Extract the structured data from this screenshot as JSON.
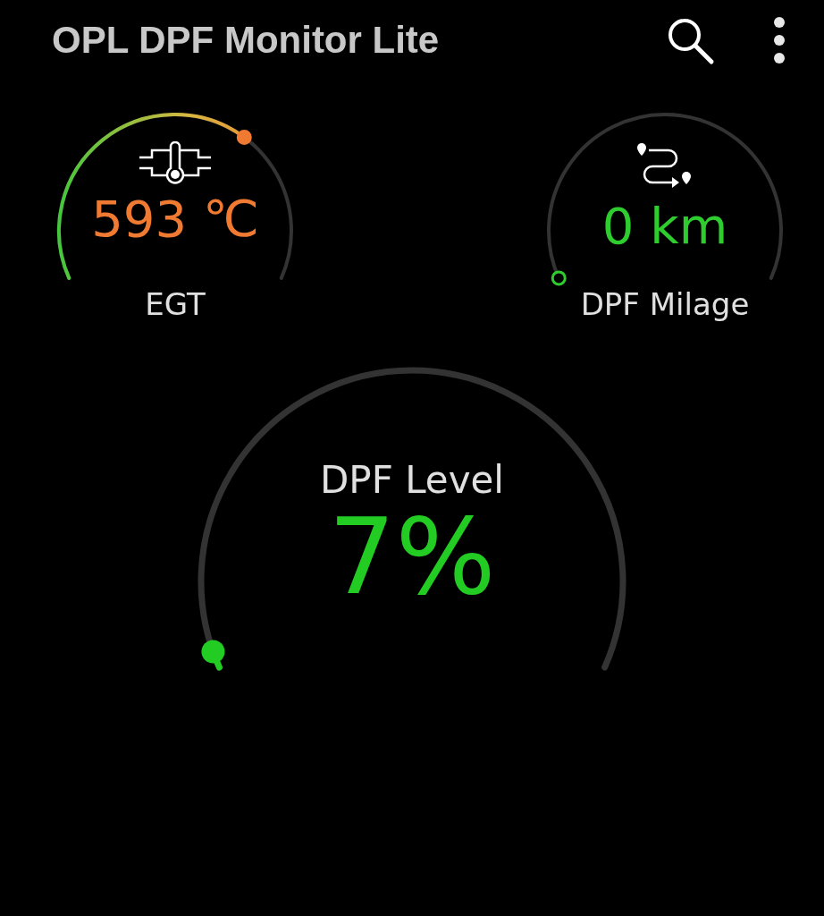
{
  "app_bar": {
    "title": "OPL DPF Monitor Lite"
  },
  "gauges": [
    {
      "kind": "small",
      "value": "593 ℃",
      "label": "EGT",
      "color": "#f07a32"
    },
    {
      "kind": "small",
      "value": "0 km",
      "label": "DPF Milage",
      "color": "#2ecc2e"
    },
    {
      "kind": "large",
      "label": "DPF Level",
      "value": "7%",
      "color": "#22cc22"
    }
  ]
}
